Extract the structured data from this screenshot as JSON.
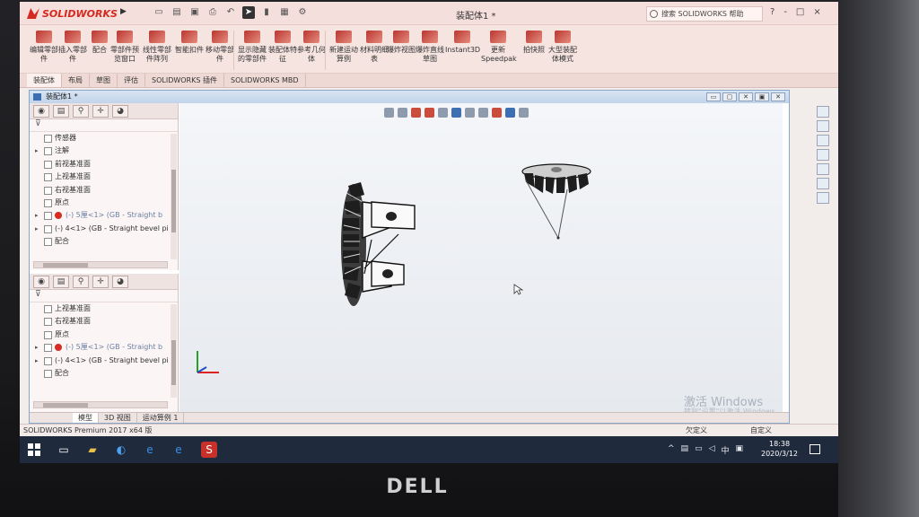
{
  "app": {
    "brand": "SOLIDWORKS",
    "doc_title": "装配体1 *",
    "search_label": "搜索 SOLIDWORKS 帮助",
    "title_right_icons": [
      "?",
      "-",
      "□",
      "×"
    ]
  },
  "ribbon": {
    "buttons": [
      {
        "label": "编辑零部件",
        "icon": "edit-component-icon"
      },
      {
        "label": "插入零部件",
        "icon": "insert-component-icon"
      },
      {
        "label": "配合",
        "icon": "mate-icon"
      },
      {
        "label": "零部件预览窗口",
        "icon": "component-preview-icon"
      },
      {
        "label": "线性零部件阵列",
        "icon": "linear-pattern-icon"
      },
      {
        "label": "智能扣件",
        "icon": "smart-fasteners-icon"
      },
      {
        "label": "移动零部件",
        "icon": "move-component-icon"
      },
      {
        "label": "显示隐藏的零部件",
        "icon": "show-hidden-icon"
      },
      {
        "label": "装配体特征",
        "icon": "assembly-features-icon"
      },
      {
        "label": "参考几何体",
        "icon": "reference-geometry-icon"
      },
      {
        "label": "新建运动算例",
        "icon": "new-motion-study-icon"
      },
      {
        "label": "材料明细表",
        "icon": "bom-icon"
      },
      {
        "label": "爆炸视图",
        "icon": "exploded-view-icon"
      },
      {
        "label": "爆炸直线草图",
        "icon": "explode-line-icon"
      },
      {
        "label": "Instant3D",
        "icon": "instant3d-icon"
      },
      {
        "label": "更新 Speedpak",
        "icon": "speedpak-icon"
      },
      {
        "label": "拍快照",
        "icon": "snapshot-icon"
      },
      {
        "label": "大型装配体模式",
        "icon": "large-assembly-icon"
      }
    ]
  },
  "tabs": [
    "装配体",
    "布局",
    "草图",
    "评估",
    "SOLIDWORKS 插件",
    "SOLIDWORKS MBD"
  ],
  "doc_window": {
    "caption": "装配体1 *",
    "win_buttons": [
      "▭",
      "▢",
      "✕",
      "▣",
      "✕"
    ]
  },
  "tree_top": {
    "items": [
      {
        "label": "传感器",
        "icon": "sensor-icon",
        "expand": ""
      },
      {
        "label": "注解",
        "icon": "annotation-icon",
        "expand": "▸"
      },
      {
        "label": "前视基准面",
        "icon": "plane-icon",
        "expand": ""
      },
      {
        "label": "上视基准面",
        "icon": "plane-icon",
        "expand": ""
      },
      {
        "label": "右视基准面",
        "icon": "plane-icon",
        "expand": ""
      },
      {
        "label": "原点",
        "icon": "origin-icon",
        "expand": ""
      },
      {
        "label": "(-) 5厘<1> (GB - Straight b",
        "icon": "part-icon",
        "expand": "▸",
        "error": true
      },
      {
        "label": "(-) 4<1> (GB - Straight bevel pi",
        "icon": "part-icon",
        "expand": "▸"
      },
      {
        "label": "配合",
        "icon": "mates-icon",
        "expand": ""
      }
    ]
  },
  "tree_bottom": {
    "items": [
      {
        "label": "上视基准面",
        "icon": "plane-icon",
        "expand": ""
      },
      {
        "label": "右视基准面",
        "icon": "plane-icon",
        "expand": ""
      },
      {
        "label": "原点",
        "icon": "origin-icon",
        "expand": ""
      },
      {
        "label": "(-) 5厘<1> (GB - Straight b",
        "icon": "part-icon",
        "expand": "▸",
        "error": true
      },
      {
        "label": "(-) 4<1> (GB - Straight bevel pi",
        "icon": "part-icon",
        "expand": "▸"
      },
      {
        "label": "配合",
        "icon": "mates-icon",
        "expand": ""
      }
    ]
  },
  "bottom_tabs": [
    "模型",
    "3D 视图",
    "运动算例 1"
  ],
  "watermark": {
    "line1": "激活 Windows",
    "line2": "转到\"设置\"以激活 Windows。"
  },
  "status": {
    "left": "SOLIDWORKS Premium 2017 x64 版",
    "right1": "欠定义",
    "right2": "自定义"
  },
  "taskbar": {
    "time": "18:38",
    "date": "2020/3/12",
    "ime": "中"
  },
  "colors": {
    "brand_red": "#d6281f",
    "ribbon_bg": "#f6e4e1",
    "taskbar": "#1f2a3d"
  }
}
